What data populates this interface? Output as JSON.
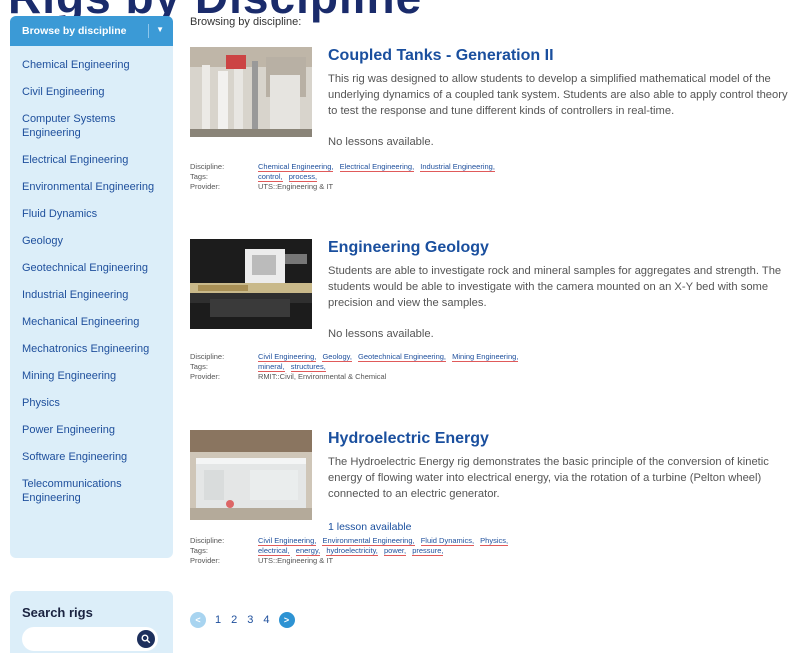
{
  "page": {
    "heading": "Rigs by Discipline"
  },
  "sidebar": {
    "browse_label": "Browse by discipline",
    "disciplines": [
      "Chemical Engineering",
      "Civil Engineering",
      "Computer Systems Engineering",
      "Electrical Engineering",
      "Environmental Engineering",
      "Fluid Dynamics",
      "Geology",
      "Geotechnical Engineering",
      "Industrial Engineering",
      "Mechanical Engineering",
      "Mechatronics Engineering",
      "Mining Engineering",
      "Physics",
      "Power Engineering",
      "Software Engineering",
      "Telecommunications Engineering"
    ]
  },
  "search": {
    "title": "Search rigs",
    "placeholder": ""
  },
  "main": {
    "browsing_label": "Browsing by discipline:",
    "meta_labels": {
      "discipline": "Discipline:",
      "tags": "Tags:",
      "provider": "Provider:"
    },
    "rigs": [
      {
        "title": "Coupled Tanks - Generation II",
        "description": "This rig was designed to allow students to develop a simplified mathematical model of the underlying dynamics of a coupled tank system. Students are also able to apply control theory to test the response and tune different kinds of controllers in real-time.",
        "lessons": "No lessons available.",
        "disciplines": [
          "Chemical Engineering,",
          "Electrical Engineering,",
          "Industrial Engineering,"
        ],
        "tags": [
          "control,",
          "process,"
        ],
        "provider": "UTS::Engineering & IT"
      },
      {
        "title": "Engineering Geology",
        "description": "Students are able to investigate rock and mineral samples for aggregates and strength. The students would be able to investigate with the camera mounted on an X-Y bed with some precision and view the samples.",
        "lessons": "No lessons available.",
        "disciplines": [
          "Civil Engineering,",
          "Geology,",
          "Geotechnical Engineering,",
          "Mining Engineering,"
        ],
        "tags": [
          "mineral,",
          "structures,"
        ],
        "provider": "RMIT::Civil, Environmental & Chemical"
      },
      {
        "title": "Hydroelectric Energy",
        "description": "The Hydroelectric Energy rig demonstrates the basic principle of the conversion of kinetic energy of flowing water into electrical energy, via the rotation of a turbine (Pelton wheel) connected to an electric generator.",
        "lessons": "1 lesson available",
        "disciplines": [
          "Civil Engineering,",
          "Environmental Engineering,",
          "Fluid Dynamics,",
          "Physics,"
        ],
        "tags": [
          "electrical,",
          "energy,",
          "hydroelectricity,",
          "power,",
          "pressure,"
        ],
        "provider": "UTS::Engineering & IT"
      }
    ]
  },
  "pagination": {
    "pages": [
      "1",
      "2",
      "3",
      "4"
    ],
    "current": "1"
  },
  "colors": {
    "accent": "#3b9ad6",
    "sidebar_bg": "#dceef9",
    "link": "#1e4f9c",
    "title": "#1a4f9e"
  }
}
